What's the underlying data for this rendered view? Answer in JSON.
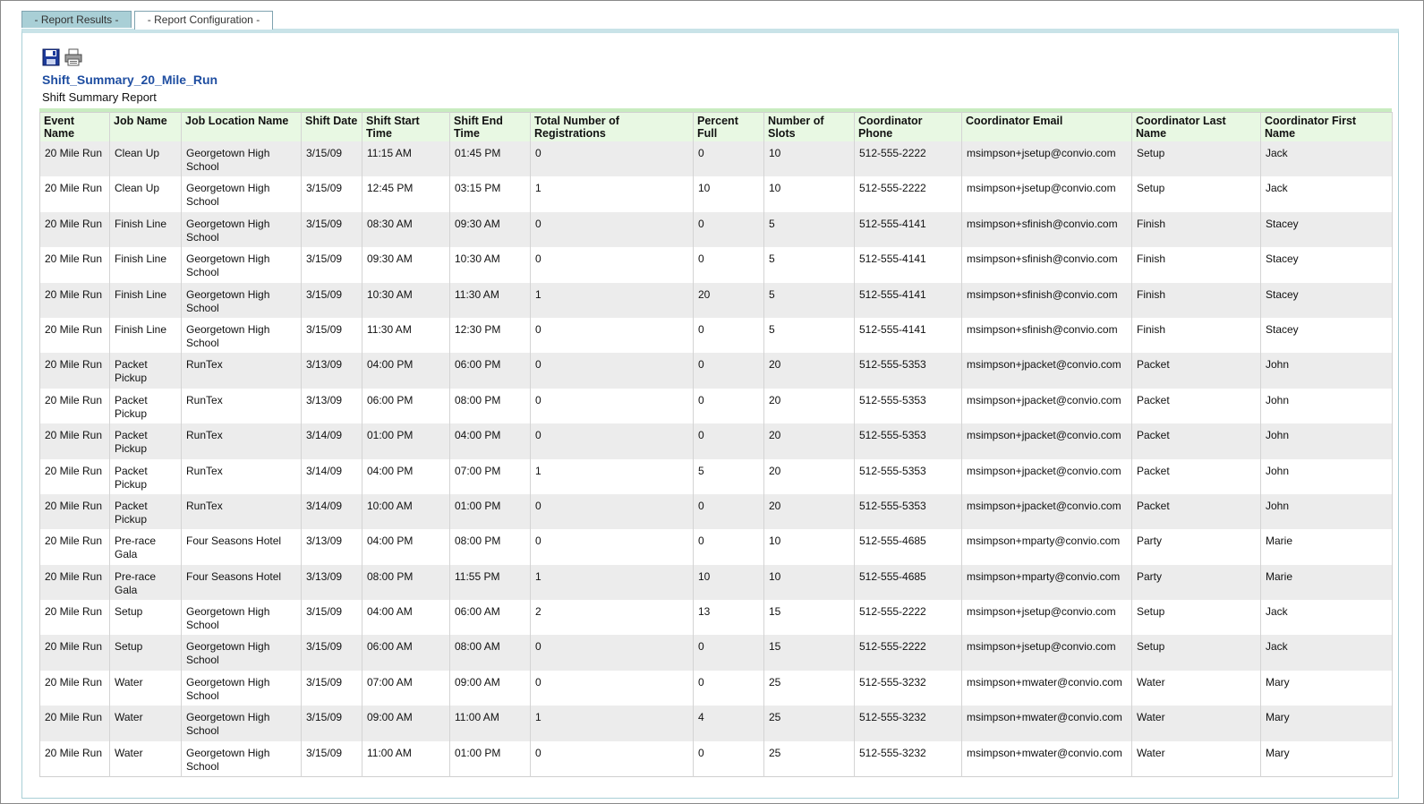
{
  "tabs": [
    {
      "label": "- Report Results -",
      "active": false
    },
    {
      "label": "- Report Configuration -",
      "active": true
    }
  ],
  "toolbar": {
    "save_icon": "save-icon",
    "print_icon": "print-icon"
  },
  "report": {
    "title": "Shift_Summary_20_Mile_Run",
    "subtitle": "Shift Summary Report"
  },
  "columns": [
    "Event Name",
    "Job Name",
    "Job Location Name",
    "Shift Date",
    "Shift Start Time",
    "Shift End Time",
    "Total Number of Registrations",
    "Percent Full",
    "Number of Slots",
    "Coordinator Phone",
    "Coordinator Email",
    "Coordinator Last Name",
    "Coordinator First Name"
  ],
  "rows": [
    [
      "20 Mile Run",
      "Clean Up",
      "Georgetown High School",
      "3/15/09",
      "11:15 AM",
      "01:45 PM",
      "0",
      "0",
      "10",
      "512-555-2222",
      "msimpson+jsetup@convio.com",
      "Setup",
      "Jack"
    ],
    [
      "20 Mile Run",
      "Clean Up",
      "Georgetown High School",
      "3/15/09",
      "12:45 PM",
      "03:15 PM",
      "1",
      "10",
      "10",
      "512-555-2222",
      "msimpson+jsetup@convio.com",
      "Setup",
      "Jack"
    ],
    [
      "20 Mile Run",
      "Finish Line",
      "Georgetown High School",
      "3/15/09",
      "08:30 AM",
      "09:30 AM",
      "0",
      "0",
      "5",
      "512-555-4141",
      "msimpson+sfinish@convio.com",
      "Finish",
      "Stacey"
    ],
    [
      "20 Mile Run",
      "Finish Line",
      "Georgetown High School",
      "3/15/09",
      "09:30 AM",
      "10:30 AM",
      "0",
      "0",
      "5",
      "512-555-4141",
      "msimpson+sfinish@convio.com",
      "Finish",
      "Stacey"
    ],
    [
      "20 Mile Run",
      "Finish Line",
      "Georgetown High School",
      "3/15/09",
      "10:30 AM",
      "11:30 AM",
      "1",
      "20",
      "5",
      "512-555-4141",
      "msimpson+sfinish@convio.com",
      "Finish",
      "Stacey"
    ],
    [
      "20 Mile Run",
      "Finish Line",
      "Georgetown High School",
      "3/15/09",
      "11:30 AM",
      "12:30 PM",
      "0",
      "0",
      "5",
      "512-555-4141",
      "msimpson+sfinish@convio.com",
      "Finish",
      "Stacey"
    ],
    [
      "20 Mile Run",
      "Packet Pickup",
      "RunTex",
      "3/13/09",
      "04:00 PM",
      "06:00 PM",
      "0",
      "0",
      "20",
      "512-555-5353",
      "msimpson+jpacket@convio.com",
      "Packet",
      "John"
    ],
    [
      "20 Mile Run",
      "Packet Pickup",
      "RunTex",
      "3/13/09",
      "06:00 PM",
      "08:00 PM",
      "0",
      "0",
      "20",
      "512-555-5353",
      "msimpson+jpacket@convio.com",
      "Packet",
      "John"
    ],
    [
      "20 Mile Run",
      "Packet Pickup",
      "RunTex",
      "3/14/09",
      "01:00 PM",
      "04:00 PM",
      "0",
      "0",
      "20",
      "512-555-5353",
      "msimpson+jpacket@convio.com",
      "Packet",
      "John"
    ],
    [
      "20 Mile Run",
      "Packet Pickup",
      "RunTex",
      "3/14/09",
      "04:00 PM",
      "07:00 PM",
      "1",
      "5",
      "20",
      "512-555-5353",
      "msimpson+jpacket@convio.com",
      "Packet",
      "John"
    ],
    [
      "20 Mile Run",
      "Packet Pickup",
      "RunTex",
      "3/14/09",
      "10:00 AM",
      "01:00 PM",
      "0",
      "0",
      "20",
      "512-555-5353",
      "msimpson+jpacket@convio.com",
      "Packet",
      "John"
    ],
    [
      "20 Mile Run",
      "Pre-race Gala",
      "Four Seasons Hotel",
      "3/13/09",
      "04:00 PM",
      "08:00 PM",
      "0",
      "0",
      "10",
      "512-555-4685",
      "msimpson+mparty@convio.com",
      "Party",
      "Marie"
    ],
    [
      "20 Mile Run",
      "Pre-race Gala",
      "Four Seasons Hotel",
      "3/13/09",
      "08:00 PM",
      "11:55 PM",
      "1",
      "10",
      "10",
      "512-555-4685",
      "msimpson+mparty@convio.com",
      "Party",
      "Marie"
    ],
    [
      "20 Mile Run",
      "Setup",
      "Georgetown High School",
      "3/15/09",
      "04:00 AM",
      "06:00 AM",
      "2",
      "13",
      "15",
      "512-555-2222",
      "msimpson+jsetup@convio.com",
      "Setup",
      "Jack"
    ],
    [
      "20 Mile Run",
      "Setup",
      "Georgetown High School",
      "3/15/09",
      "06:00 AM",
      "08:00 AM",
      "0",
      "0",
      "15",
      "512-555-2222",
      "msimpson+jsetup@convio.com",
      "Setup",
      "Jack"
    ],
    [
      "20 Mile Run",
      "Water",
      "Georgetown High School",
      "3/15/09",
      "07:00 AM",
      "09:00 AM",
      "0",
      "0",
      "25",
      "512-555-3232",
      "msimpson+mwater@convio.com",
      "Water",
      "Mary"
    ],
    [
      "20 Mile Run",
      "Water",
      "Georgetown High School",
      "3/15/09",
      "09:00 AM",
      "11:00 AM",
      "1",
      "4",
      "25",
      "512-555-3232",
      "msimpson+mwater@convio.com",
      "Water",
      "Mary"
    ],
    [
      "20 Mile Run",
      "Water",
      "Georgetown High School",
      "3/15/09",
      "11:00 AM",
      "01:00 PM",
      "0",
      "0",
      "25",
      "512-555-3232",
      "msimpson+mwater@convio.com",
      "Water",
      "Mary"
    ]
  ]
}
